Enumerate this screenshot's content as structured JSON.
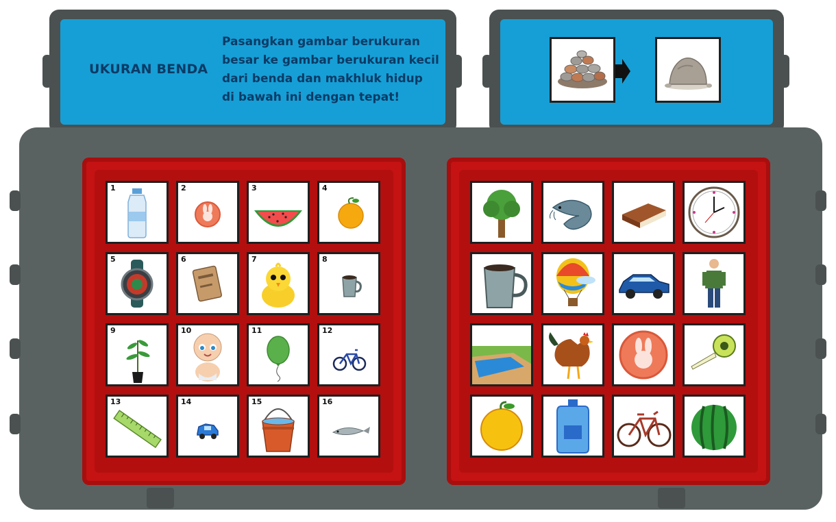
{
  "header": {
    "title": "UKURAN BENDA",
    "instruction_lines": [
      "Pasangkan gambar berukuran",
      "besar ke gambar berukuran kecil",
      "dari benda dan makhluk hidup",
      "di bawah ini dengan tepat!"
    ]
  },
  "example": {
    "left_icon": "stone-pile-icon",
    "arrow_icon": "arrow-right-icon",
    "right_icon": "rock-icon"
  },
  "small_items": [
    {
      "number": "1",
      "icon": "water-bottle-icon"
    },
    {
      "number": "2",
      "icon": "bunny-button-icon"
    },
    {
      "number": "3",
      "icon": "watermelon-slice-icon"
    },
    {
      "number": "4",
      "icon": "orange-icon"
    },
    {
      "number": "5",
      "icon": "wristwatch-icon"
    },
    {
      "number": "6",
      "icon": "diary-icon"
    },
    {
      "number": "7",
      "icon": "chick-icon"
    },
    {
      "number": "8",
      "icon": "small-cup-icon"
    },
    {
      "number": "9",
      "icon": "seedling-icon"
    },
    {
      "number": "10",
      "icon": "baby-icon"
    },
    {
      "number": "11",
      "icon": "balloon-icon"
    },
    {
      "number": "12",
      "icon": "small-bicycle-icon"
    },
    {
      "number": "13",
      "icon": "ruler-icon"
    },
    {
      "number": "14",
      "icon": "toy-car-icon"
    },
    {
      "number": "15",
      "icon": "bucket-icon"
    },
    {
      "number": "16",
      "icon": "small-fish-icon"
    }
  ],
  "big_items": [
    {
      "icon": "tree-icon"
    },
    {
      "icon": "catfish-icon"
    },
    {
      "icon": "book-icon"
    },
    {
      "icon": "wall-clock-icon"
    },
    {
      "icon": "mug-icon"
    },
    {
      "icon": "hot-air-balloon-icon"
    },
    {
      "icon": "car-icon"
    },
    {
      "icon": "man-icon"
    },
    {
      "icon": "swimming-pool-icon"
    },
    {
      "icon": "rooster-icon"
    },
    {
      "icon": "big-bunny-button-icon"
    },
    {
      "icon": "tape-measure-icon"
    },
    {
      "icon": "big-orange-icon"
    },
    {
      "icon": "water-gallon-icon"
    },
    {
      "icon": "bicycle-icon"
    },
    {
      "icon": "watermelon-icon"
    }
  ],
  "colors": {
    "panel": "#169fd6",
    "frame": "#4a5150",
    "board": "#5a6261",
    "tray": "#c51212",
    "text": "#0b3b66"
  }
}
